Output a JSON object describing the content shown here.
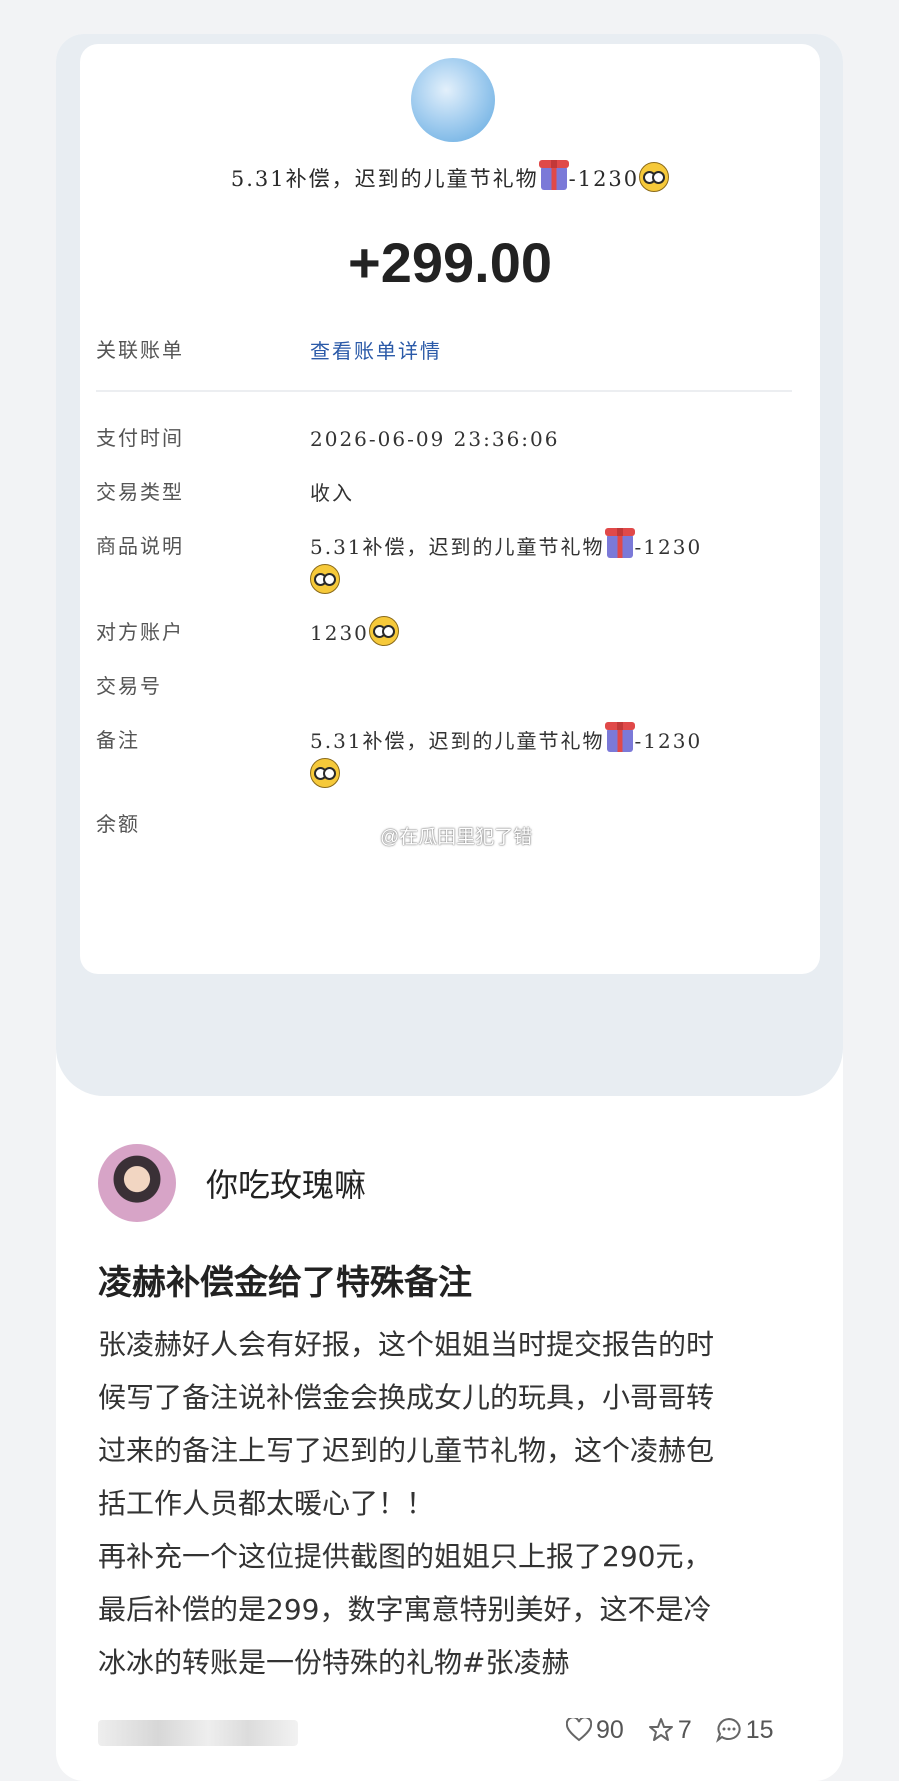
{
  "receipt": {
    "title_text": "5.31补偿，迟到的儿童节礼物",
    "title_suffix": "-1230",
    "amount": "+299.00",
    "linked_label": "关联账单",
    "linked_value": "查看账单详情",
    "rows": [
      {
        "label": "支付时间",
        "value": "2026-06-09  23:36:06"
      },
      {
        "label": "交易类型",
        "value": "收入"
      },
      {
        "label": "商品说明",
        "value": "5.31补偿，迟到的儿童节礼物",
        "suffix": "-1230"
      },
      {
        "label": "对方账户",
        "value": "1230"
      },
      {
        "label": "交易号",
        "value": ""
      },
      {
        "label": "备注",
        "value": "5.31补偿，迟到的儿童节礼物",
        "suffix": "-1230"
      },
      {
        "label": "余额",
        "value": ""
      }
    ],
    "watermark": "@在瓜田里犯了错"
  },
  "post": {
    "username": "你吃玫瑰嘛",
    "title": "凌赫补偿金给了特殊备注",
    "body": "张凌赫好人会有好报，这个姐姐当时提交报告的时\n候写了备注说补偿金会换成女儿的玩具，小哥哥转\n过来的备注上写了迟到的儿童节礼物，这个凌赫包\n括工作人员都太暖心了！！\n再补充一个这位提供截图的姐姐只上报了290元，\n最后补偿的是299，数字寓意特别美好，这不是冷\n冰冰的转账是一份特殊的礼物#张凌赫",
    "likes": "90",
    "favorites": "7",
    "comments": "15"
  },
  "colors": {
    "link": "#2b5aa8",
    "outer_bg": "#e8edf2"
  }
}
